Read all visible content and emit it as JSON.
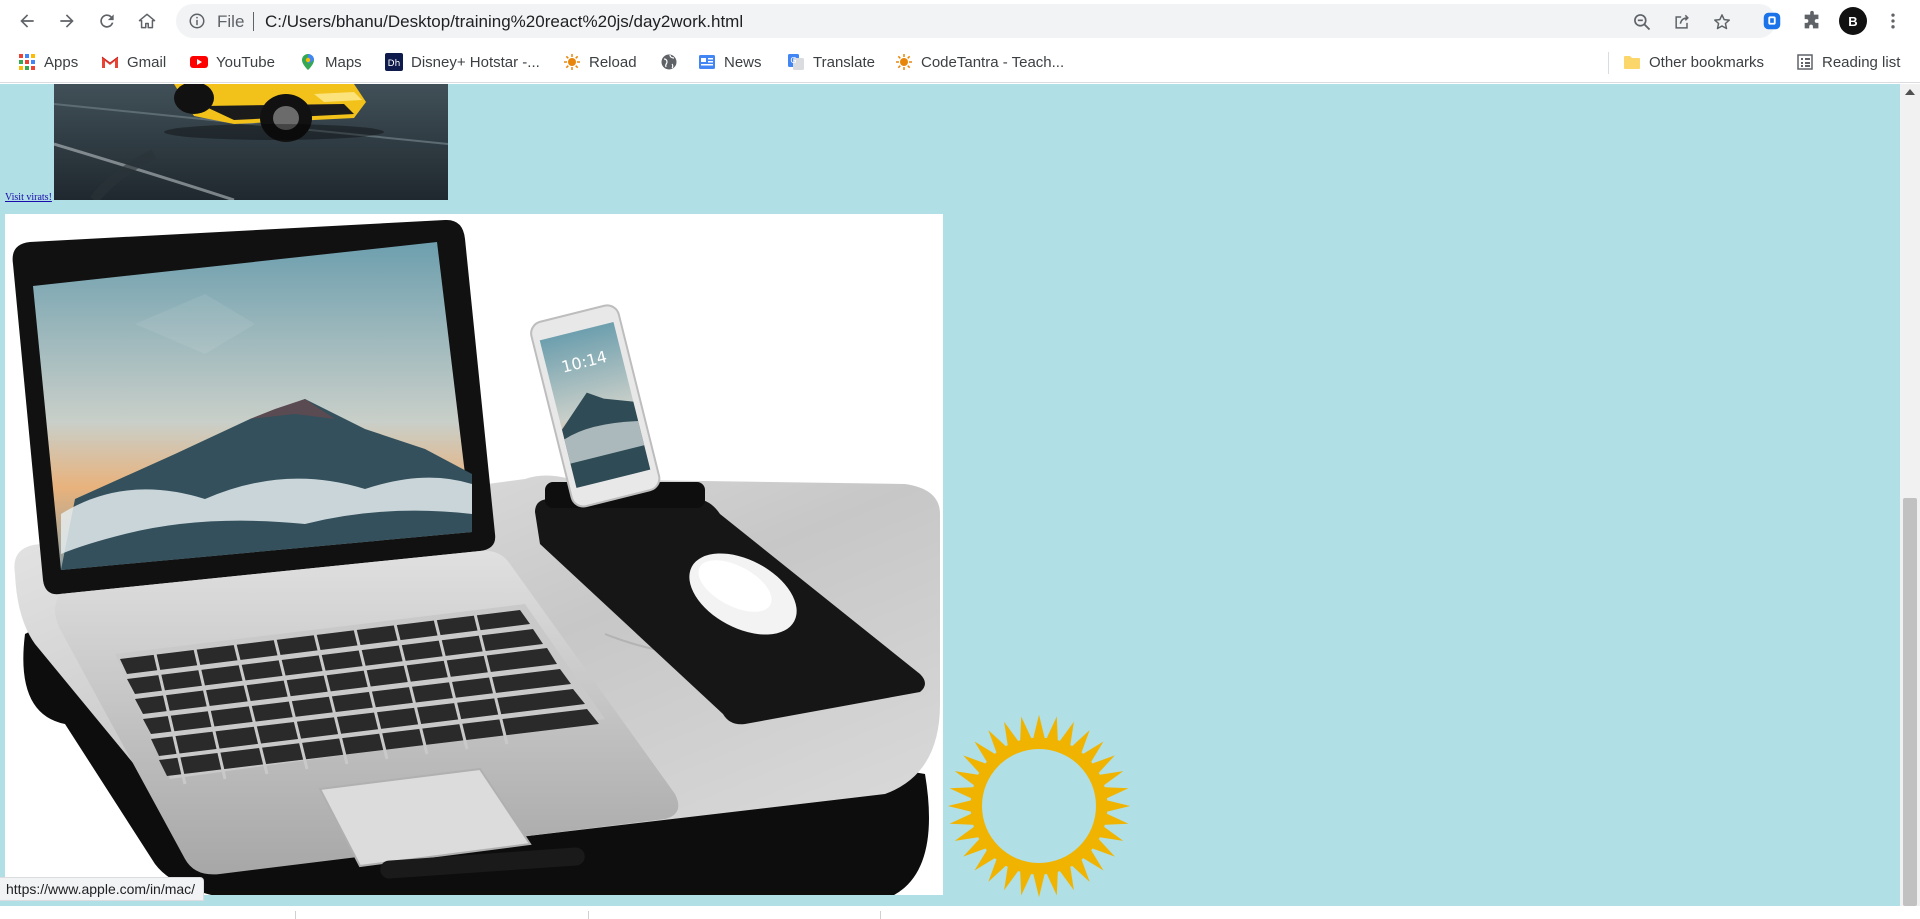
{
  "browser": {
    "address": {
      "file_label": "File",
      "url": "C:/Users/bhanu/Desktop/training%20react%20js/day2work.html"
    },
    "profile_initial": "B",
    "nav_icons": [
      "back-arrow-icon",
      "forward-arrow-icon",
      "reload-icon",
      "home-icon"
    ],
    "toolbar_icons": [
      "zoom-icon",
      "share-icon",
      "star-icon",
      "extension-shield-icon",
      "puzzle-icon",
      "more-vert-icon"
    ]
  },
  "bookmarks": {
    "items": [
      {
        "label": "Apps",
        "icon": "apps-grid-icon"
      },
      {
        "label": "Gmail",
        "icon": "gmail-icon"
      },
      {
        "label": "YouTube",
        "icon": "youtube-icon"
      },
      {
        "label": "Maps",
        "icon": "maps-pin-icon"
      },
      {
        "label": "Disney+ Hotstar -...",
        "icon": "hotstar-icon"
      },
      {
        "label": "Reload",
        "icon": "sun-favicon-icon"
      },
      {
        "label": "",
        "icon": "globe-icon"
      },
      {
        "label": "News",
        "icon": "news-icon"
      },
      {
        "label": "Translate",
        "icon": "translate-icon"
      },
      {
        "label": "CodeTantra - Teach...",
        "icon": "sun-favicon-icon"
      }
    ],
    "other_label": "Other bookmarks",
    "reading_list_label": "Reading list"
  },
  "page": {
    "link_text": "Visit virats!",
    "background_color": "#b0dfe5"
  },
  "status_bar": {
    "url": "https://www.apple.com/in/mac/"
  }
}
